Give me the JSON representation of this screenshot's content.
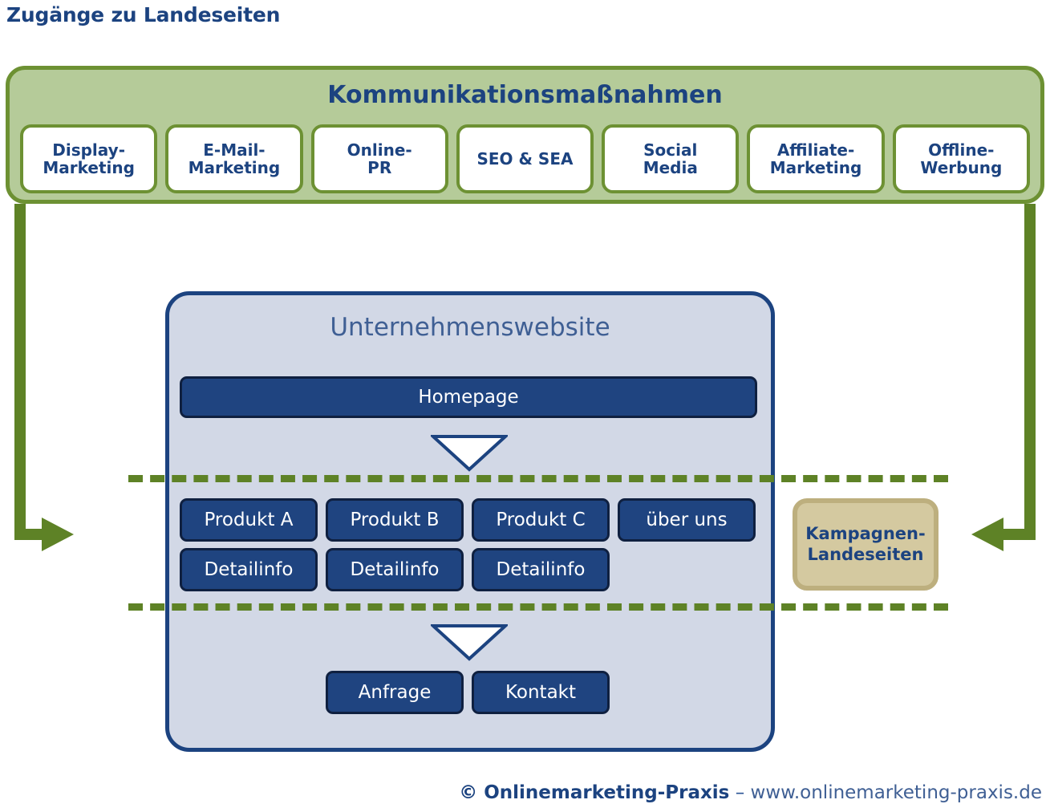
{
  "page": {
    "title": "Zugänge zu Landeseiten"
  },
  "measures": {
    "title": "Kommunikationsmaßnahmen",
    "channels": [
      {
        "label": "Display-\nMarketing",
        "name": "display-marketing"
      },
      {
        "label": "E-Mail-\nMarketing",
        "name": "email-marketing"
      },
      {
        "label": "Online-\nPR",
        "name": "online-pr"
      },
      {
        "label": "SEO & SEA",
        "name": "seo-sea"
      },
      {
        "label": "Social\nMedia",
        "name": "social-media"
      },
      {
        "label": "Affiliate-\nMarketing",
        "name": "affiliate-marketing"
      },
      {
        "label": "Offline-\nWerbung",
        "name": "offline-werbung"
      }
    ]
  },
  "website": {
    "title": "Unternehmenswebsite",
    "homepage": "Homepage",
    "products": [
      "Produkt A",
      "Produkt B",
      "Produkt C"
    ],
    "about": "über uns",
    "details": [
      "Detailinfo",
      "Detailinfo",
      "Detailinfo"
    ],
    "conversions": [
      "Anfrage",
      "Kontakt"
    ]
  },
  "campaign": {
    "label": "Kampagnen-\nLandeseiten"
  },
  "footer": {
    "brand": "© Onlinemarketing-Praxis",
    "separator": " – ",
    "url": "www.onlinemarketing-praxis.de"
  },
  "colors": {
    "brand_blue": "#1c4380",
    "node_blue": "#1f4480",
    "website_fill": "#d2d8e6",
    "green_fill": "#b5cb99",
    "green_border": "#6d9133",
    "green_arrow": "#5e8226",
    "campaign_fill": "#d4c9a0",
    "campaign_border": "#bdaf7e"
  }
}
